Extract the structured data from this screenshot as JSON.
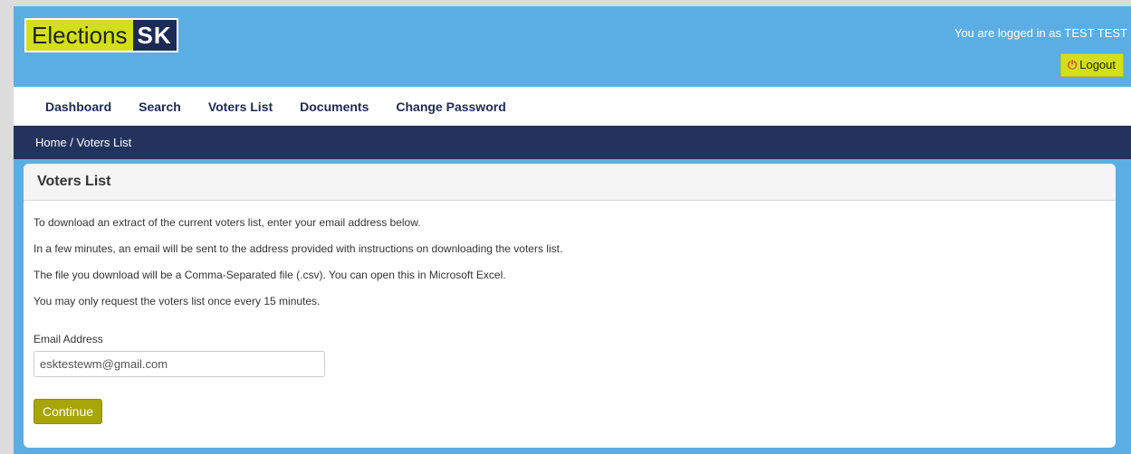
{
  "header": {
    "logo_part1": "Elections",
    "logo_part2": "SK",
    "login_status": "You are logged in as TEST TEST",
    "logout_label": "Logout",
    "logout_icon": "power-icon"
  },
  "nav": {
    "items": [
      {
        "label": "Dashboard"
      },
      {
        "label": "Search"
      },
      {
        "label": "Voters List"
      },
      {
        "label": "Documents"
      },
      {
        "label": "Change Password"
      }
    ]
  },
  "breadcrumb": {
    "home": "Home",
    "separator": " / ",
    "current": "Voters List"
  },
  "panel": {
    "title": "Voters List",
    "paragraphs": [
      "To download an extract of the current voters list, enter your email address below.",
      "In a few minutes, an email will be sent to the address provided with instructions on downloading the voters list.",
      "The file you download will be a Comma-Separated file (.csv). You can open this in Microsoft Excel.",
      "You may only request the voters list once every 15 minutes."
    ],
    "email_label": "Email Address",
    "email_value": "esktestewm@gmail.com",
    "continue_label": "Continue"
  },
  "colors": {
    "header_bg": "#5aaee4",
    "logo_yellow": "#d3df1a",
    "navy": "#24335e",
    "continue_button": "#a7a50a",
    "logout_button": "#d3df1a"
  }
}
